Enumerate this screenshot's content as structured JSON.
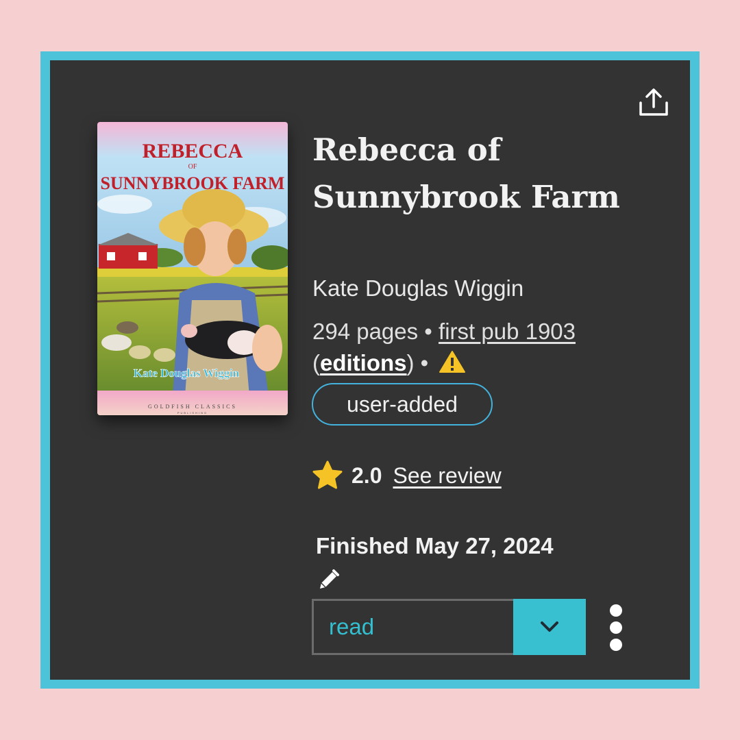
{
  "book": {
    "title": "Rebecca of Sunnybrook Farm",
    "author": "Kate Douglas Wiggin",
    "pages_text": "294 pages • ",
    "first_pub": "first pub 1903",
    "open_paren": " (",
    "editions": "editions",
    "close_paren": ")  •",
    "tag": "user-added",
    "cover": {
      "title_line1": "REBECCA",
      "title_of": "OF",
      "title_line2": "SUNNYBROOK FARM",
      "author": "Kate Douglas Wiggin",
      "publisher": "GOLDFISH CLASSICS",
      "publisher_sub": "PUBLISHING"
    }
  },
  "rating": {
    "value": "2.0",
    "review_link": "See review"
  },
  "status": {
    "finished_text": "Finished May 27, 2024",
    "shelf": "read"
  },
  "colors": {
    "page_bg": "#f6d0d1",
    "frame": "#4cc3d8",
    "panel": "#333333",
    "accent": "#38bfd0",
    "tag_border": "#43b3dd",
    "star": "#f5c325",
    "warning": "#f5c325"
  },
  "icons": {
    "share": "share-icon",
    "warning": "warning-icon",
    "star": "star-icon",
    "edit": "pencil-icon",
    "dropdown": "chevron-down-icon",
    "more": "more-vertical-icon"
  }
}
